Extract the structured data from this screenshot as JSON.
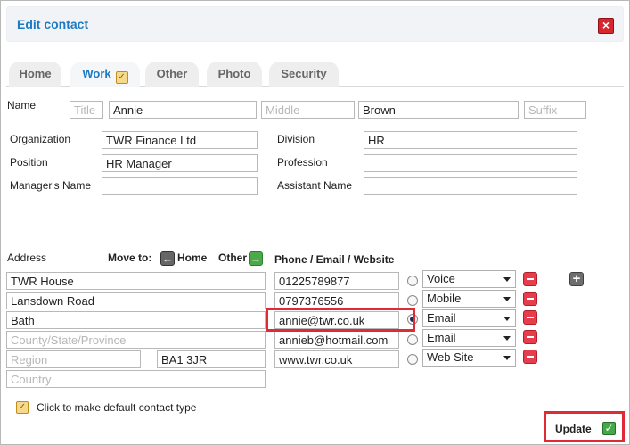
{
  "dialog": {
    "title": "Edit contact",
    "close_icon": "close-icon"
  },
  "tabs": [
    {
      "label": "Home"
    },
    {
      "label": "Work"
    },
    {
      "label": "Other"
    },
    {
      "label": "Photo"
    },
    {
      "label": "Security"
    }
  ],
  "name": {
    "label": "Name",
    "title_placeholder": "Title",
    "first": "Annie",
    "middle_placeholder": "Middle",
    "last": "Brown",
    "suffix_placeholder": "Suffix"
  },
  "work": {
    "organization_label": "Organization",
    "organization_value": "TWR Finance Ltd",
    "division_label": "Division",
    "division_value": "HR",
    "position_label": "Position",
    "position_value": "HR Manager",
    "profession_label": "Profession",
    "managers_name_label": "Manager's Name",
    "assistant_name_label": "Assistant Name"
  },
  "address": {
    "label": "Address",
    "move_to_label": "Move to:",
    "move_home_label": "Home",
    "move_other_label": "Other",
    "line1": "TWR House",
    "line2": "Lansdown Road",
    "city": "Bath",
    "county_placeholder": "County/State/Province",
    "region_placeholder": "Region",
    "postcode": "BA1 3JR",
    "country_placeholder": "Country"
  },
  "contact_methods": {
    "label": "Phone / Email / Website",
    "rows": [
      {
        "value": "01225789877",
        "type": "Voice",
        "checked": false
      },
      {
        "value": "0797376556",
        "type": "Mobile",
        "checked": false
      },
      {
        "value": "annie@twr.co.uk",
        "type": "Email",
        "checked": true
      },
      {
        "value": "annieb@hotmail.com",
        "type": "Email",
        "checked": false
      },
      {
        "value": "www.twr.co.uk",
        "type": "Web Site",
        "checked": false
      }
    ]
  },
  "footer": {
    "default_contact_hint": "Click to make default contact type",
    "update_label": "Update"
  },
  "colors": {
    "accent": "#1b7bc3",
    "highlight": "#e02a35",
    "remove": "#e53d4b",
    "update_icon": "#46a84a"
  }
}
